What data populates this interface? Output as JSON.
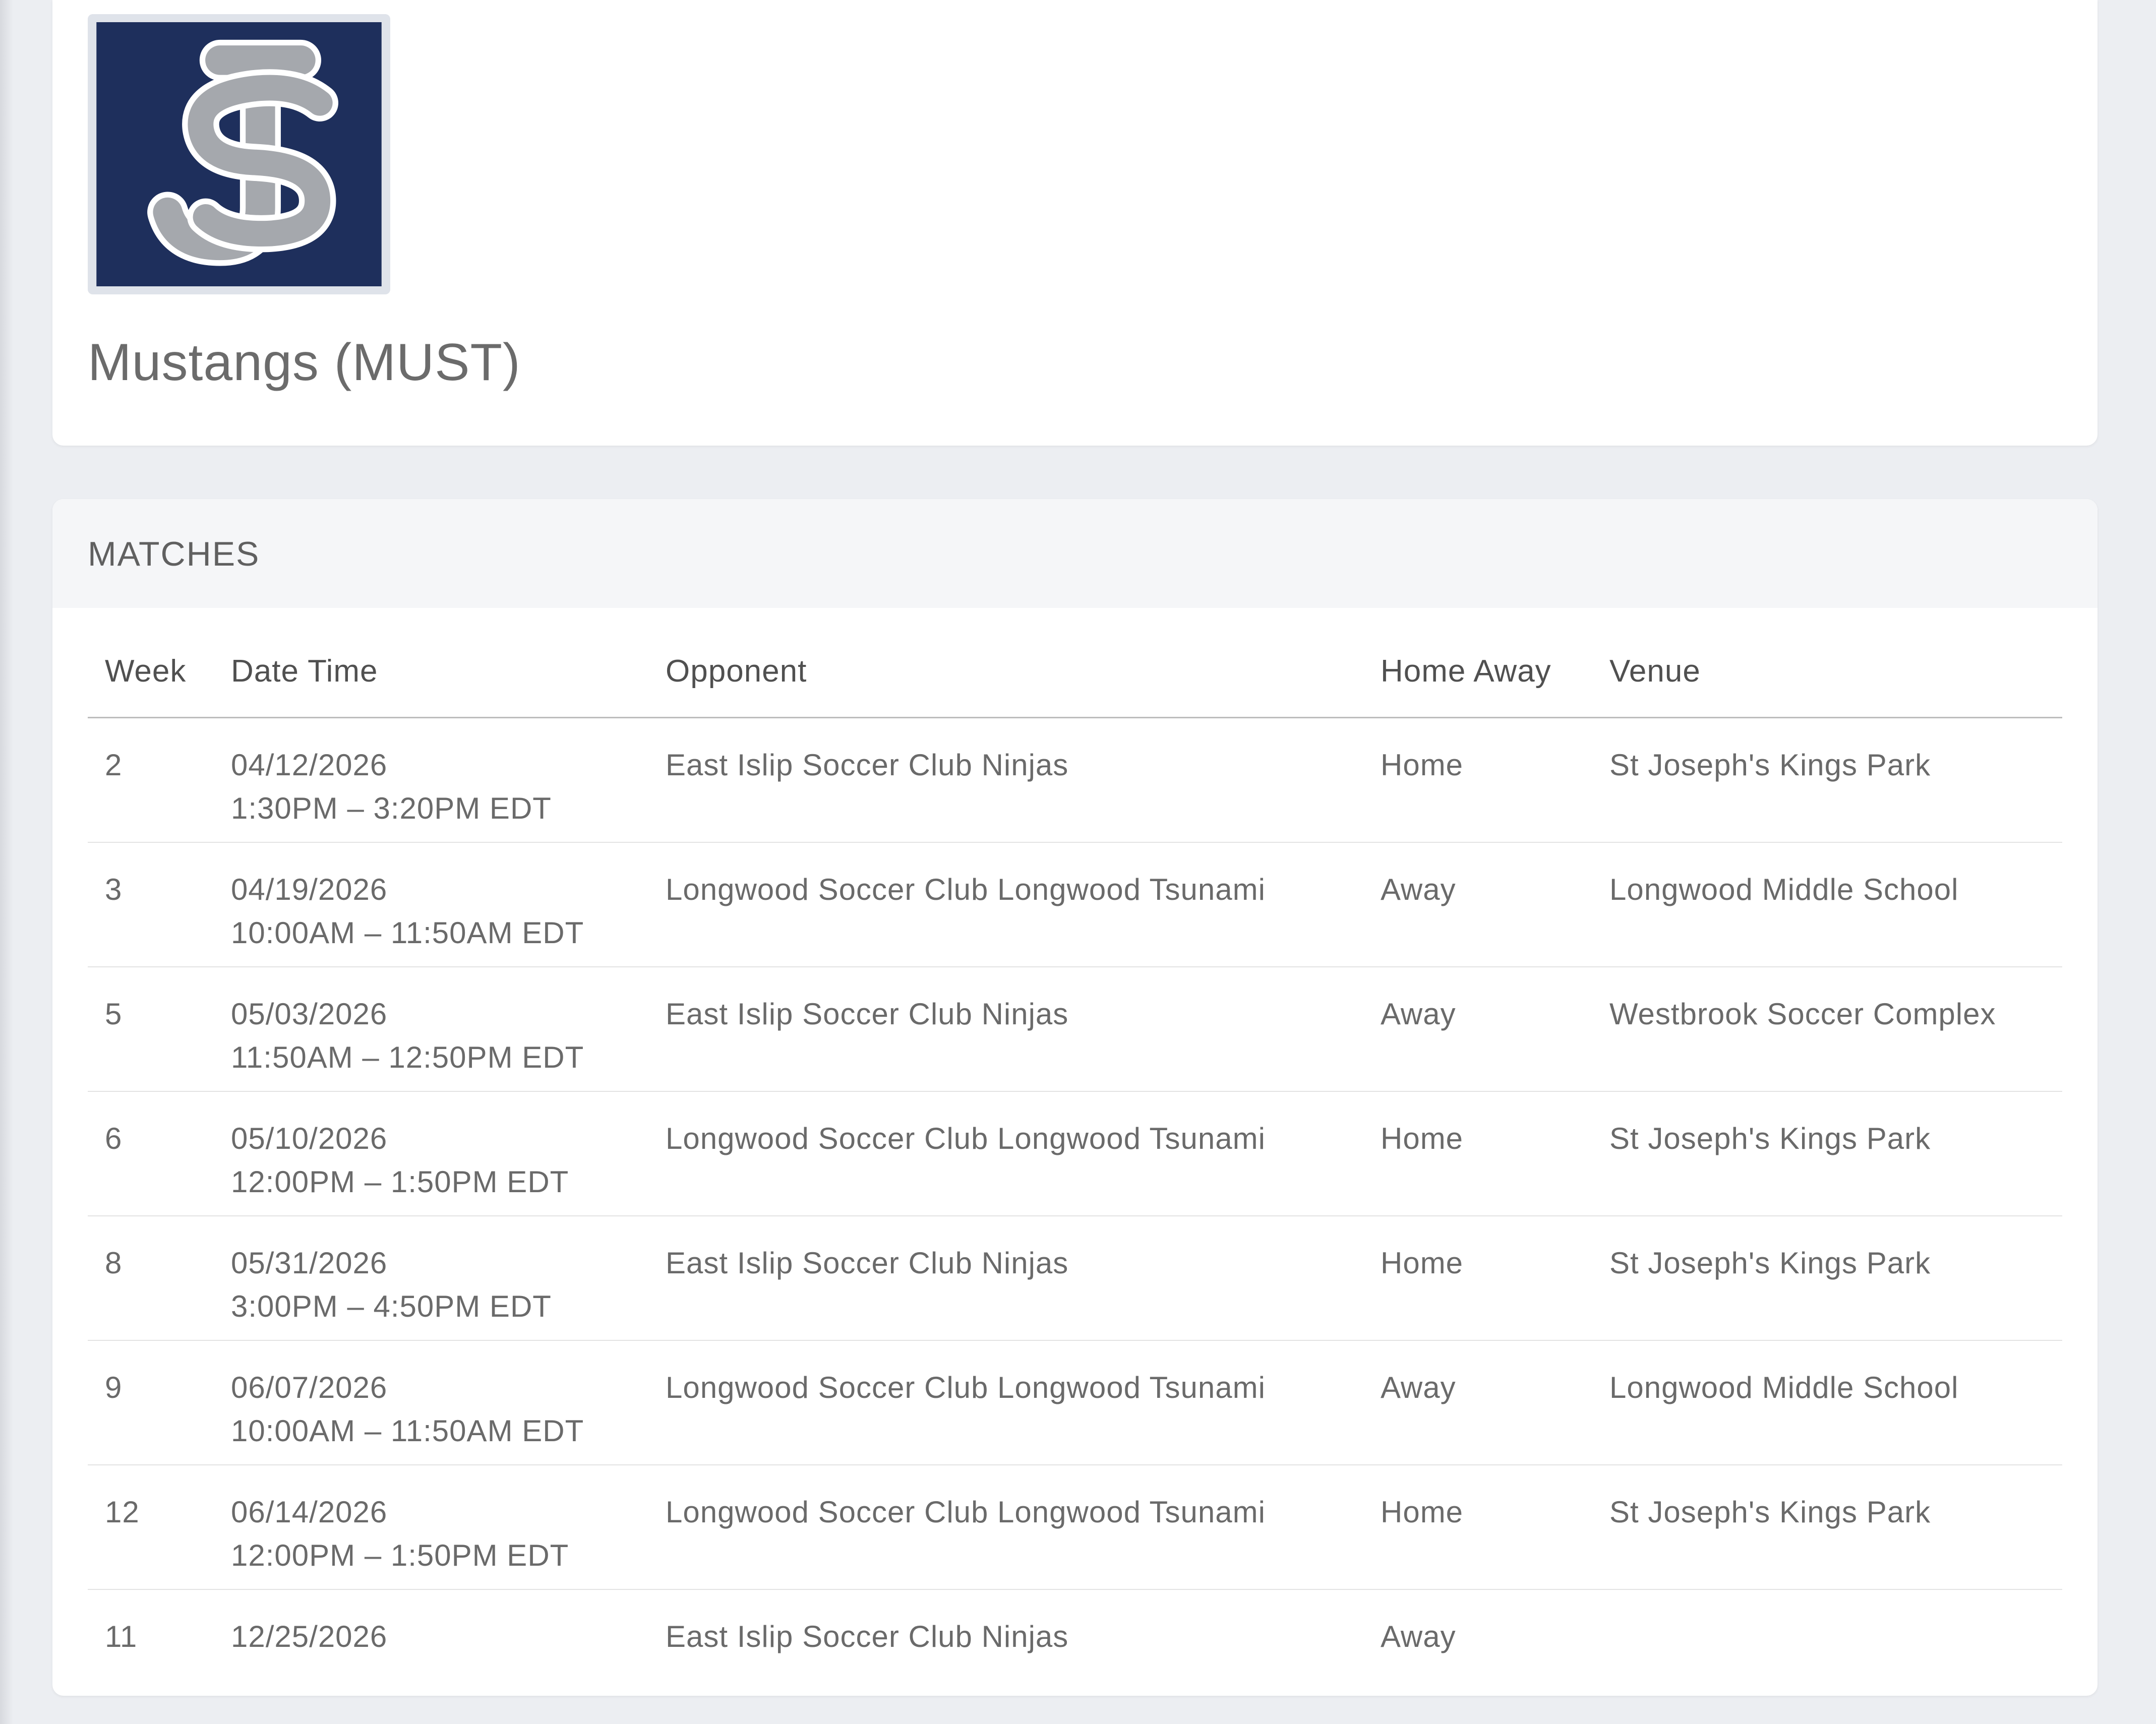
{
  "team": {
    "name": "Mustangs (MUST)",
    "logo_icon": "js-monogram-logo",
    "logo_colors": {
      "background": "#1e2f5c",
      "letters": "#a5a8ad",
      "outline": "#ffffff"
    }
  },
  "matches": {
    "title": "MATCHES",
    "columns": {
      "week": "Week",
      "datetime": "Date Time",
      "opponent": "Opponent",
      "homeaway": "Home Away",
      "venue": "Venue"
    },
    "rows": [
      {
        "week": "2",
        "date": "04/12/2026",
        "time": "1:30PM – 3:20PM EDT",
        "opponent": "East Islip Soccer Club Ninjas",
        "homeaway": "Home",
        "venue": "St Joseph's Kings Park"
      },
      {
        "week": "3",
        "date": "04/19/2026",
        "time": "10:00AM – 11:50AM EDT",
        "opponent": "Longwood Soccer Club Longwood Tsunami",
        "homeaway": "Away",
        "venue": "Longwood Middle School"
      },
      {
        "week": "5",
        "date": "05/03/2026",
        "time": "11:50AM – 12:50PM EDT",
        "opponent": "East Islip Soccer Club Ninjas",
        "homeaway": "Away",
        "venue": "Westbrook Soccer Complex"
      },
      {
        "week": "6",
        "date": "05/10/2026",
        "time": "12:00PM – 1:50PM EDT",
        "opponent": "Longwood Soccer Club Longwood Tsunami",
        "homeaway": "Home",
        "venue": "St Joseph's Kings Park"
      },
      {
        "week": "8",
        "date": "05/31/2026",
        "time": "3:00PM – 4:50PM EDT",
        "opponent": "East Islip Soccer Club Ninjas",
        "homeaway": "Home",
        "venue": "St Joseph's Kings Park"
      },
      {
        "week": "9",
        "date": "06/07/2026",
        "time": "10:00AM – 11:50AM EDT",
        "opponent": "Longwood Soccer Club Longwood Tsunami",
        "homeaway": "Away",
        "venue": "Longwood Middle School"
      },
      {
        "week": "12",
        "date": "06/14/2026",
        "time": "12:00PM – 1:50PM EDT",
        "opponent": "Longwood Soccer Club Longwood Tsunami",
        "homeaway": "Home",
        "venue": "St Joseph's Kings Park"
      },
      {
        "week": "11",
        "date": "12/25/2026",
        "time": "",
        "opponent": "East Islip Soccer Club Ninjas",
        "homeaway": "Away",
        "venue": ""
      }
    ]
  }
}
